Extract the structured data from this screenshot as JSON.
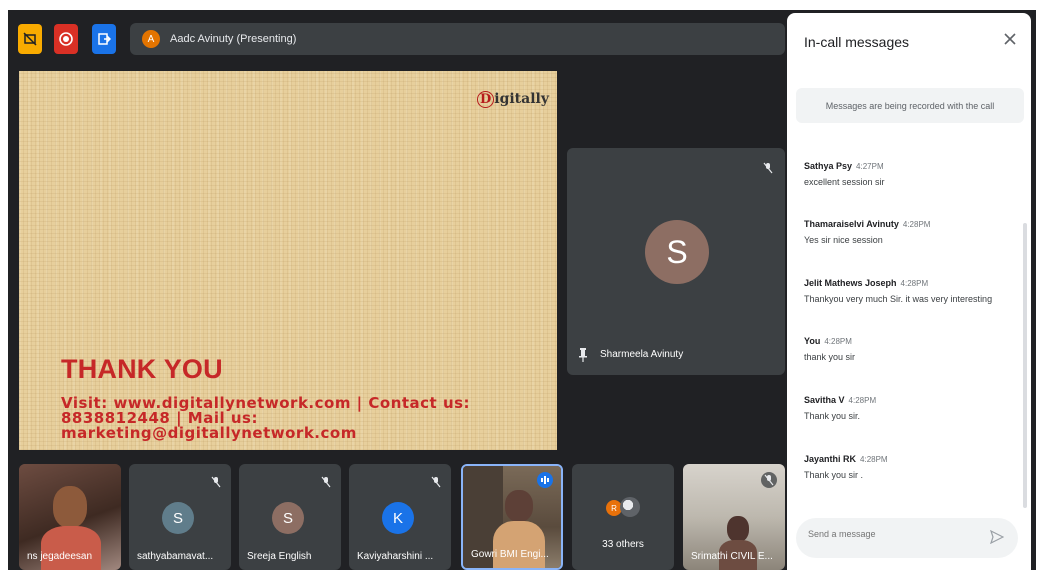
{
  "top_bar": {
    "presenter_initial": "A",
    "presenter_label": "Aadc Avinuty (Presenting)"
  },
  "slide": {
    "logo_letter": "D",
    "logo_rest": "igitally",
    "thank_you": "THANK YOU",
    "visit_line1": "Visit: www.digitallynetwork.com | Contact us:",
    "visit_line2": "8838812448 | Mail us:",
    "visit_line3": "marketing@digitallynetwork.com"
  },
  "side_tile": {
    "initial": "S",
    "name": "Sharmeela Avinuty"
  },
  "participants": [
    {
      "name": "ns jegadeesan"
    },
    {
      "name": "sathyabamavat...",
      "initial": "S",
      "color": "#607d8b"
    },
    {
      "name": "Sreeja English",
      "initial": "S",
      "color": "#8d6e63"
    },
    {
      "name": "Kaviyaharshini ...",
      "initial": "K",
      "color": "#1a73e8"
    },
    {
      "name": "Gowri BMI Engi..."
    },
    {
      "name": "33 others",
      "initial": "R"
    },
    {
      "name": "Srimathi CIVIL E..."
    }
  ],
  "chat": {
    "title": "In-call messages",
    "record_note": "Messages are being recorded with the call",
    "messages": [
      {
        "sender": "Sathya Psy",
        "time": "4:27PM",
        "text": "excellent session sir"
      },
      {
        "sender": "Thamaraiselvi Avinuty",
        "time": "4:28PM",
        "text": "Yes sir nice session"
      },
      {
        "sender": "Jelit Mathews Joseph",
        "time": "4:28PM",
        "text": "Thankyou very much Sir. it was very interesting"
      },
      {
        "sender": "You",
        "time": "4:28PM",
        "text": "thank you sir"
      },
      {
        "sender": "Savitha V",
        "time": "4:28PM",
        "text": "Thank you sir."
      },
      {
        "sender": "Jayanthi RK",
        "time": "4:28PM",
        "text": "Thank you sir ."
      }
    ],
    "input_placeholder": "Send a message"
  },
  "colors": {
    "meet_bg": "#202124",
    "tile_bg": "#3c4043",
    "slide_red": "#c62828",
    "active_speaker": "#8ab4f8"
  },
  "icons": [
    "present-icon",
    "record-icon",
    "share-icon",
    "mic-off-icon",
    "pin-icon",
    "close-icon",
    "send-icon",
    "audio-active-icon"
  ]
}
